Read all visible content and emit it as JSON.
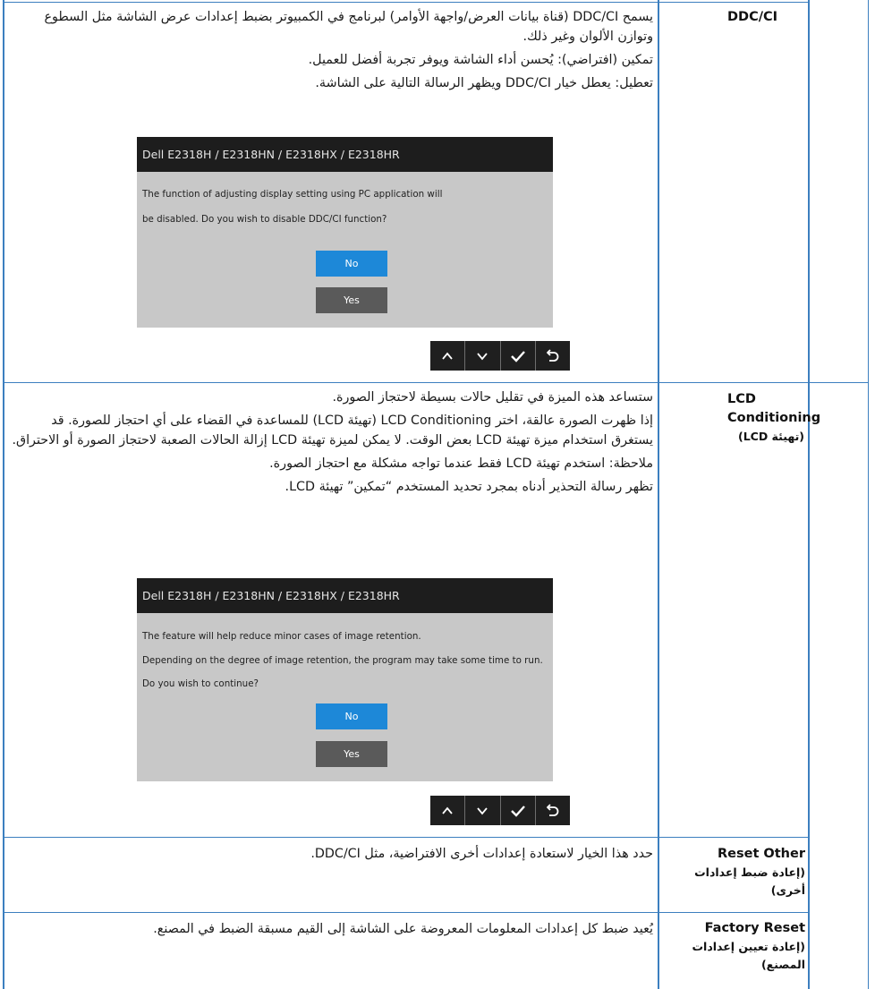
{
  "rows": [
    {
      "label": "DDC/CI",
      "label_ar": "",
      "paragraphs": [
        "يسمح DDC/CI (قناة بيانات العرض/واجهة الأوامر) لبرنامج في الكمبيوتر بضبط إعدادات عرض الشاشة مثل السطوع وتوازن الألوان وغير ذلك.",
        "تمكين (افتراضي): يُحسن أداء الشاشة ويوفر تجربة أفضل للعميل.",
        "تعطيل: يعطل خيار DDC/CI ويظهر الرسالة التالية على الشاشة."
      ],
      "dialog": {
        "title": "Dell E2318H / E2318HN / E2318HX / E2318HR",
        "lines": [
          "The function of adjusting display setting using PC application will",
          "be disabled. Do you wish to disable DDC/CI function?"
        ],
        "no_label": "No",
        "yes_label": "Yes"
      }
    },
    {
      "label": "LCD Conditioning",
      "label_ar": "(تهيئة LCD)",
      "paragraphs": [
        "ستساعد هذه الميزة في تقليل حالات بسيطة لاحتجاز الصورة.",
        "إذا ظهرت الصورة عالقة، اختر LCD Conditioning (تهيئة LCD) للمساعدة في القضاء على أي احتجاز للصورة. قد يستغرق استخدام ميزة تهيئة LCD بعض الوقت. لا يمكن لميزة تهيئة LCD إزالة الحالات الصعبة لاحتجاز الصورة أو الاحتراق.",
        "ملاحظة: استخدم تهيئة LCD فقط عندما تواجه مشكلة مع احتجاز الصورة.",
        "تظهر رسالة التحذير أدناه بمجرد تحديد المستخدم “تمكين” تهيئة LCD."
      ],
      "dialog": {
        "title": "Dell E2318H / E2318HN / E2318HX / E2318HR",
        "lines": [
          "The feature will help reduce minor cases of image retention.",
          "Depending on the degree of image retention, the program may take some time to run.",
          "Do you wish to continue?"
        ],
        "no_label": "No",
        "yes_label": "Yes"
      }
    },
    {
      "label": "Reset Other",
      "label_ar": "(إعادة ضبط إعدادات أخرى)",
      "paragraphs": [
        "حدد هذا الخيار لاستعادة إعدادات أخرى الافتراضية، مثل DDC/CI."
      ]
    },
    {
      "label": "Factory Reset",
      "label_ar": "(إعادة تعيين إعدادات المصنع)",
      "paragraphs": [
        "يُعيد ضبط كل إعدادات المعلومات المعروضة على الشاشة إلى القيم مسبقة الضبط في المصنع."
      ]
    }
  ],
  "nav_buttons": [
    "up-icon",
    "down-icon",
    "check-icon",
    "back-icon"
  ],
  "colors": {
    "rule": "#3c7fbf",
    "dialog_bg": "#c8c8c8",
    "dialog_title_bg": "#1d1d1d",
    "no_button": "#1d88d8",
    "yes_button": "#5a5a5a"
  }
}
